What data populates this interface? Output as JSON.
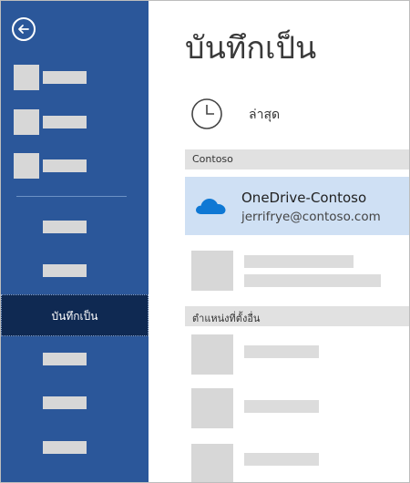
{
  "colors": {
    "sidebar": "#2b579a",
    "selected_nav": "#0f2952",
    "selected_location": "#cfe0f4",
    "section_header": "#e1e1e1",
    "onedrive_blue": "#0f78d4"
  },
  "sidebar": {
    "back_icon": "back-arrow-icon",
    "active_item": {
      "label": "บันทึกเป็น"
    }
  },
  "main": {
    "title": "บันทึกเป็น",
    "recent": {
      "label": "ล่าสุด",
      "icon": "clock-icon"
    },
    "sections": [
      {
        "label": "Contoso"
      },
      {
        "label": "ตำแหน่งที่ตั้งอื่น"
      }
    ],
    "onedrive": {
      "icon": "onedrive-cloud-icon",
      "name": "OneDrive-Contoso",
      "email": "jerrifrye@contoso.com"
    }
  }
}
